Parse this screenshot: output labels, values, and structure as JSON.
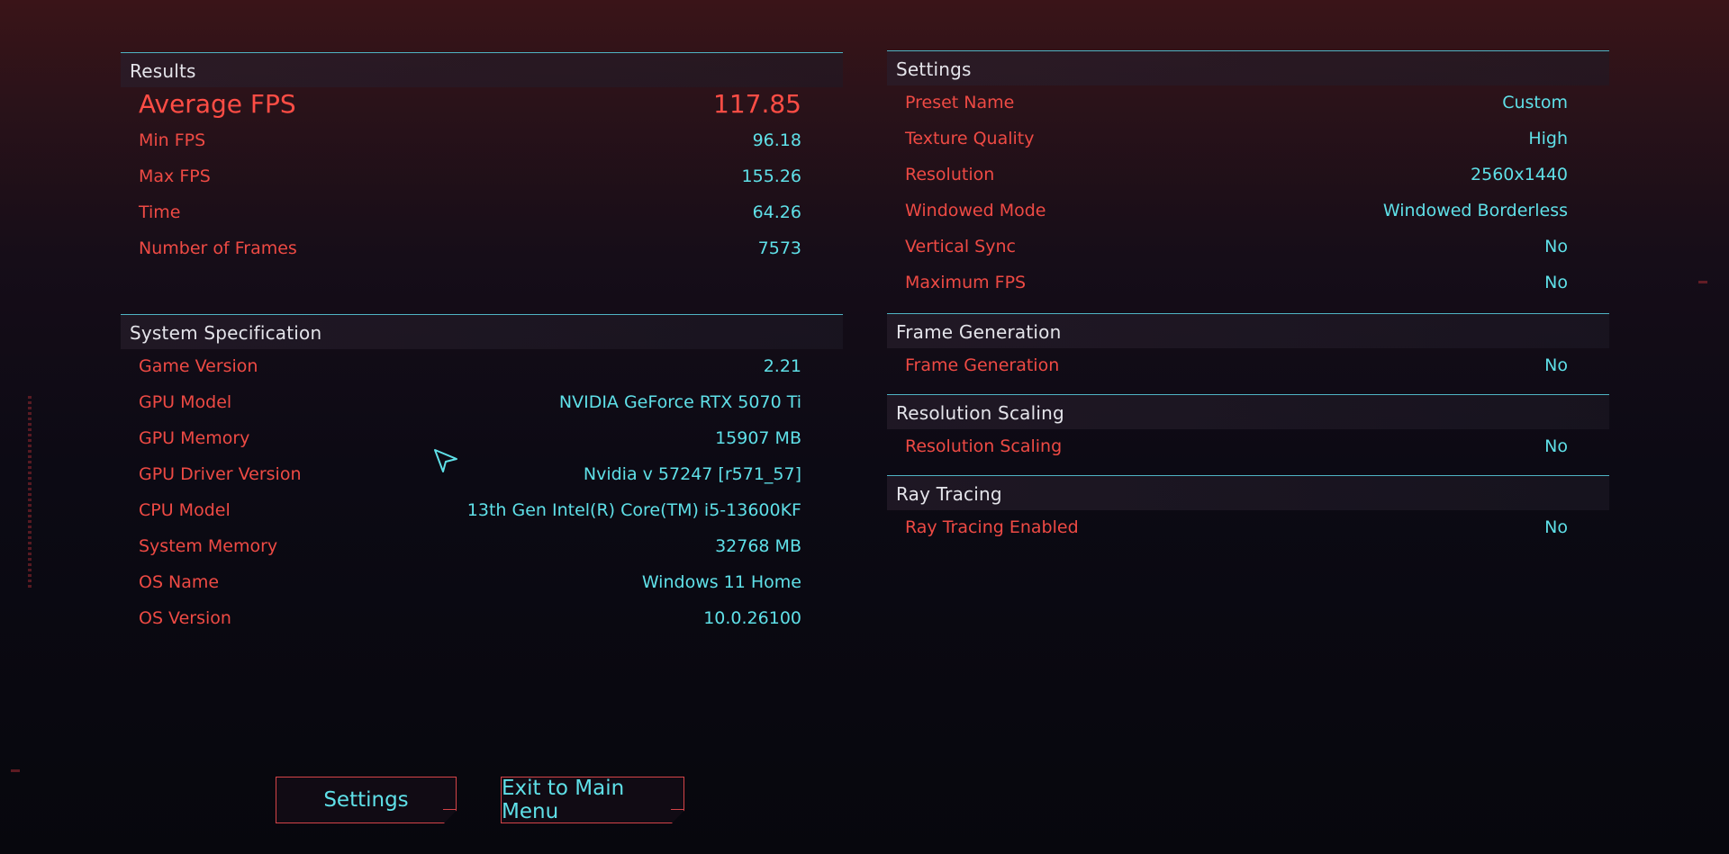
{
  "results": {
    "title": "Results",
    "average": {
      "label": "Average FPS",
      "value": "117.85"
    },
    "rows": [
      {
        "label": "Min FPS",
        "value": "96.18"
      },
      {
        "label": "Max FPS",
        "value": "155.26"
      },
      {
        "label": "Time",
        "value": "64.26"
      },
      {
        "label": "Number of Frames",
        "value": "7573"
      }
    ]
  },
  "system": {
    "title": "System Specification",
    "rows": [
      {
        "label": "Game Version",
        "value": "2.21"
      },
      {
        "label": "GPU Model",
        "value": "NVIDIA GeForce RTX 5070 Ti"
      },
      {
        "label": "GPU Memory",
        "value": "15907 MB"
      },
      {
        "label": "GPU Driver Version",
        "value": "Nvidia v 57247 [r571_57]"
      },
      {
        "label": "CPU Model",
        "value": "13th Gen Intel(R) Core(TM) i5-13600KF"
      },
      {
        "label": "System Memory",
        "value": "32768 MB"
      },
      {
        "label": "OS Name",
        "value": "Windows 11 Home"
      },
      {
        "label": "OS Version",
        "value": "10.0.26100"
      }
    ]
  },
  "settings": {
    "title": "Settings",
    "rows": [
      {
        "label": "Preset Name",
        "value": "Custom"
      },
      {
        "label": "Texture Quality",
        "value": "High"
      },
      {
        "label": "Resolution",
        "value": "2560x1440"
      },
      {
        "label": "Windowed Mode",
        "value": "Windowed Borderless"
      },
      {
        "label": "Vertical Sync",
        "value": "No"
      },
      {
        "label": "Maximum FPS",
        "value": "No"
      }
    ]
  },
  "frame_generation": {
    "title": "Frame Generation",
    "rows": [
      {
        "label": "Frame Generation",
        "value": "No"
      }
    ]
  },
  "resolution_scaling": {
    "title": "Resolution Scaling",
    "rows": [
      {
        "label": "Resolution Scaling",
        "value": "No"
      }
    ]
  },
  "ray_tracing": {
    "title": "Ray Tracing",
    "rows": [
      {
        "label": "Ray Tracing Enabled",
        "value": "No"
      }
    ]
  },
  "buttons": {
    "settings": "Settings",
    "exit": "Exit to Main Menu"
  },
  "colors": {
    "label_red": "#ee4a44",
    "value_cyan": "#5fe0e8",
    "divider": "#4fb4c4"
  }
}
